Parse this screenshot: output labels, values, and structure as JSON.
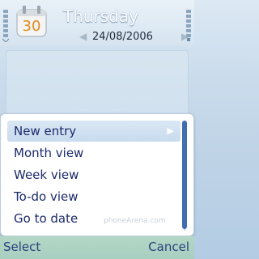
{
  "header": {
    "day": "Thursday",
    "date": "24/08/2006",
    "calendar_day": "30"
  },
  "menu": {
    "items": [
      {
        "label": "New entry",
        "selected": true,
        "has_submenu": true
      },
      {
        "label": "Month view"
      },
      {
        "label": "Week view"
      },
      {
        "label": "To-do view"
      },
      {
        "label": "Go to date"
      }
    ]
  },
  "softkeys": {
    "left": "Select",
    "right": "Cancel"
  },
  "icons": {
    "signal": "signal-strength-icon",
    "battery": "battery-icon",
    "app": "calendar-app-icon",
    "submenu": "chevron-right-icon"
  },
  "colors": {
    "menu_text": "#1b2a6b",
    "softkey_text": "#2b3f7f",
    "scroll_thumb": "#3f6fb0"
  },
  "watermark": "phoneArena.com"
}
